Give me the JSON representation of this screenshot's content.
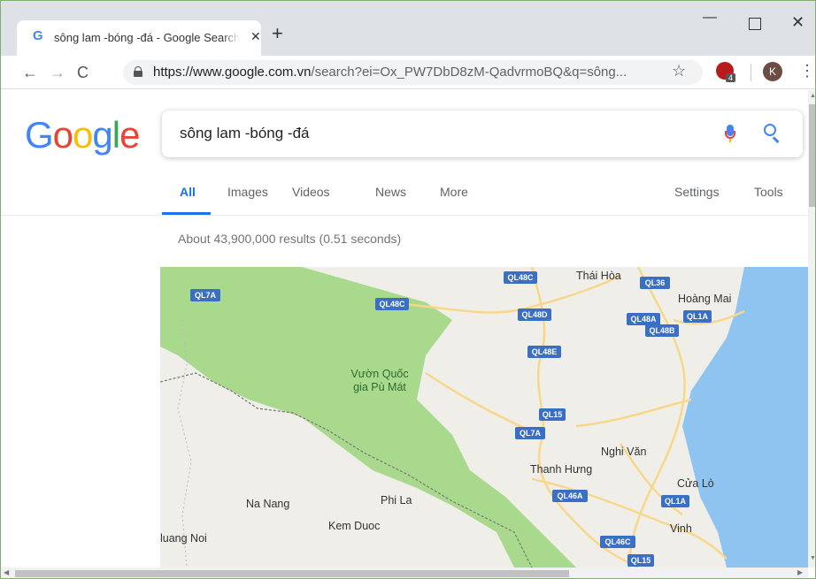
{
  "browser": {
    "tab": {
      "favicon": "G",
      "title": "sông lam -bóng -đá - Google Search",
      "close": "✕"
    },
    "new_tab": "+",
    "window_controls": {
      "minimize": "—",
      "close": "✕"
    },
    "nav": {
      "back": "←",
      "forward": "→",
      "reload": "C"
    },
    "address": {
      "host": "https://www.google.com.vn",
      "path": "/search?ei=Ox_PW7DbD8zM-QadvrmoBQ&q=sông..."
    },
    "bookmark": "☆",
    "extension_badge": "4",
    "profile_initial": "K",
    "menu": "⋮"
  },
  "google": {
    "logo_letters": [
      "G",
      "o",
      "o",
      "g",
      "l",
      "e"
    ],
    "query": "sông lam -bóng -đá",
    "tabs": [
      "All",
      "Images",
      "Videos",
      "News",
      "More"
    ],
    "right_tabs": [
      "Settings",
      "Tools"
    ],
    "active_tab": "All",
    "result_stats": "About 43,900,000 results (0.51 seconds)"
  },
  "map": {
    "highway_shields": [
      "QL7A",
      "QL48C",
      "QL48C",
      "QL36",
      "QL48D",
      "QL48A",
      "QL1A",
      "QL48B",
      "QL48E",
      "QL15",
      "QL7A",
      "QL46A",
      "QL1A",
      "QL46C",
      "QL15"
    ],
    "places": [
      "Thái Hòa",
      "Hoàng Mai",
      "Vườn Quốc",
      "gia Pù Mát",
      "Nghi Văn",
      "Thanh Hưng",
      "Cửa Lò",
      "Phi La",
      "Na Nang",
      "Kem Duoc",
      "Vinh",
      "luang Noi"
    ],
    "colors": {
      "land": "#efeee9",
      "park": "#a9d98c",
      "water": "#8ec4ef",
      "road": "#f7d88a",
      "shield": "#3a6fc4"
    }
  },
  "scroll": {
    "up": "▲",
    "down": "▼",
    "left": "◀",
    "right": "▶"
  }
}
